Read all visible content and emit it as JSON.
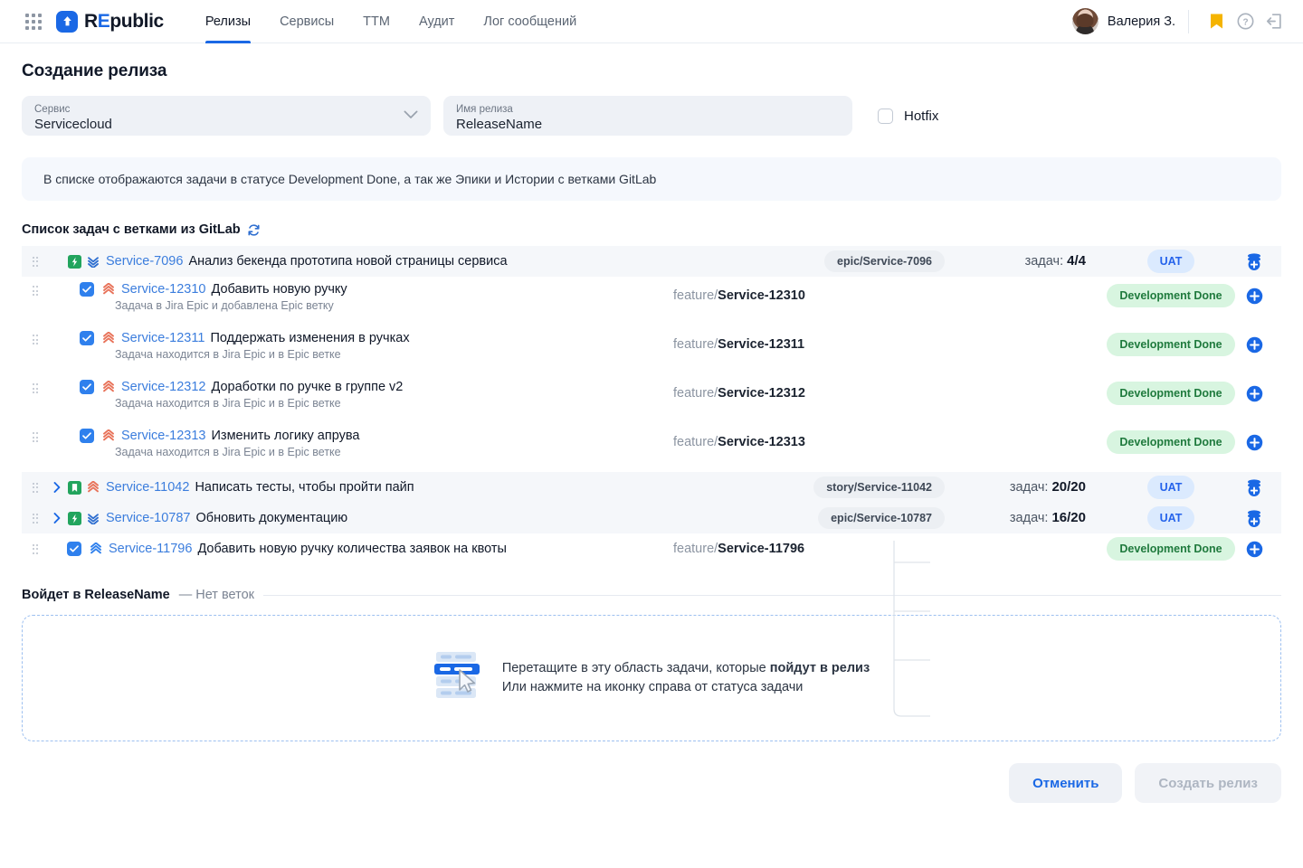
{
  "header": {
    "apps_icon": "grid-apps-icon",
    "logo_icon": "republic-arrow-logo",
    "brand_re": "REpublic",
    "nav": [
      {
        "label": "Релизы",
        "active": true
      },
      {
        "label": "Сервисы",
        "active": false
      },
      {
        "label": "TTM",
        "active": false
      },
      {
        "label": "Аудит",
        "active": false
      },
      {
        "label": "Лог сообщений",
        "active": false
      }
    ],
    "user": "Валерия З.",
    "bookmark_icon": "bookmark-icon",
    "help_icon": "help-circle-icon",
    "logout_icon": "logout-icon"
  },
  "page": {
    "title": "Создание релиза",
    "service_label": "Сервис",
    "service_value": "Servicecloud",
    "release_label": "Имя релиза",
    "release_value": "ReleaseName",
    "hotfix_label": "Hotfix",
    "banner": "В списке отображаются задачи в статусе Development Done, а так же Эпики и Истории с ветками GitLab",
    "list_title": "Список задач с ветками из GitLab",
    "refresh_icon": "refresh-icon"
  },
  "labels": {
    "tasks_prefix": "задач:",
    "branch_prefix": "feature/"
  },
  "rows": [
    {
      "kind": "group",
      "expanded": true,
      "type_icon": "epic-icon",
      "priority_icon": "priority-low-icon",
      "key": "Service-7096",
      "summary": "Анализ бекенда прототипа новой страницы сервиса",
      "branch": "epic/Service-7096",
      "count": "4/4",
      "status": "UAT",
      "add_icon": "add-group-icon"
    },
    {
      "kind": "sub",
      "checked": true,
      "priority_icon": "priority-high-icon",
      "key": "Service-12310",
      "summary": "Добавить новую ручку",
      "note": "Задача в Jira Epic и добавлена Epic ветку",
      "branch_prefix": "feature/",
      "branch_suffix": "Service-12310",
      "status": "Development Done",
      "add_icon": "add-task-icon"
    },
    {
      "kind": "sub",
      "checked": true,
      "priority_icon": "priority-high-icon",
      "key": "Service-12311",
      "summary": "Поддержать изменения в ручках",
      "note": "Задача находится в Jira Epic и в Epic ветке",
      "branch_prefix": "feature/",
      "branch_suffix": "Service-12311",
      "status": "Development Done",
      "add_icon": "add-task-icon"
    },
    {
      "kind": "sub",
      "checked": true,
      "priority_icon": "priority-high-icon",
      "key": "Service-12312",
      "summary": "Доработки по ручке в группе v2",
      "note": "Задача находится в Jira Epic и в Epic ветке",
      "branch_prefix": "feature/",
      "branch_suffix": "Service-12312",
      "status": "Development Done",
      "add_icon": "add-task-icon"
    },
    {
      "kind": "sub",
      "checked": true,
      "priority_icon": "priority-high-icon",
      "key": "Service-12313",
      "summary": "Изменить логику апрува",
      "note": "Задача находится в Jira Epic и в Epic ветке",
      "branch_prefix": "feature/",
      "branch_suffix": "Service-12313",
      "status": "Development Done",
      "add_icon": "add-task-icon"
    },
    {
      "kind": "group",
      "expanded": false,
      "type_icon": "story-icon",
      "priority_icon": "priority-high-icon",
      "key": "Service-11042",
      "summary": "Написать тесты, чтобы пройти пайп",
      "branch": "story/Service-11042",
      "count": "20/20",
      "status": "UAT",
      "add_icon": "add-group-icon"
    },
    {
      "kind": "group",
      "expanded": false,
      "type_icon": "epic-icon",
      "priority_icon": "priority-low-icon",
      "key": "Service-10787",
      "summary": "Обновить документацию",
      "branch": "epic/Service-10787",
      "count": "16/20",
      "status": "UAT",
      "add_icon": "add-group-icon"
    },
    {
      "kind": "plain",
      "checked": true,
      "priority_icon": "priority-highest-blue-icon",
      "key": "Service-11796",
      "summary": "Добавить новую ручку количества заявок на квоты",
      "branch_prefix": "feature/",
      "branch_suffix": "Service-11796",
      "status": "Development Done",
      "add_icon": "add-task-icon"
    }
  ],
  "dropzone": {
    "title": "Войдет в ReleaseName",
    "subtitle": "— Нет веток",
    "illustration_icon": "drag-drop-list-icon",
    "line1_a": "Перетащите в эту область задачи, которые ",
    "line1_b": "пойдут в релиз",
    "line2": "Или нажмите на иконку справа от статуса задачи"
  },
  "footer": {
    "cancel": "Отменить",
    "create": "Создать релиз"
  },
  "colors": {
    "accent": "#1a68e5",
    "link": "#3b7ddd",
    "status_done_bg": "#d8f5e0",
    "status_done_fg": "#1f7a3d",
    "status_uat_bg": "#dbeafe",
    "status_uat_fg": "#2563eb",
    "epic_green": "#22a45d",
    "priority_high": "#e8735a",
    "priority_low": "#2f6fd0"
  }
}
